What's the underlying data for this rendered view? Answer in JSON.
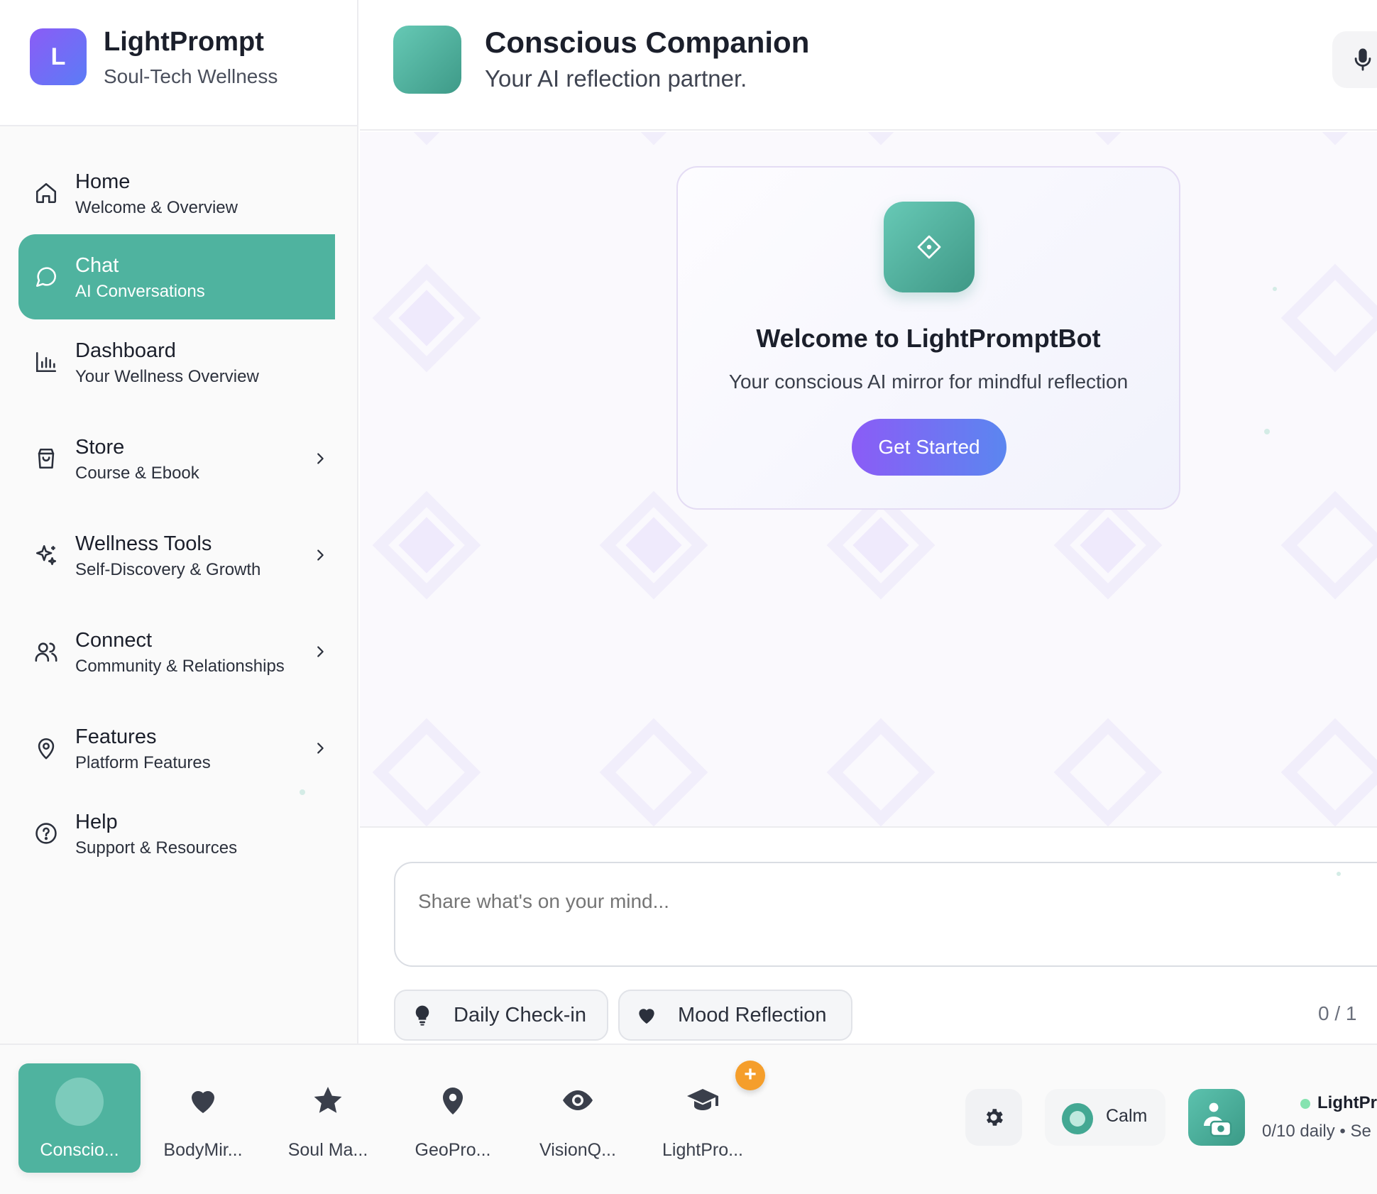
{
  "brand": {
    "logo_letter": "L",
    "name": "LightPrompt",
    "tagline": "Soul-Tech Wellness"
  },
  "nav": {
    "items": [
      {
        "title": "Home",
        "subtitle": "Welcome & Overview",
        "icon": "home-icon"
      },
      {
        "title": "Chat",
        "subtitle": "AI Conversations",
        "icon": "chat-bubble-icon",
        "active": true
      },
      {
        "title": "Dashboard",
        "subtitle": "Your Wellness Overview",
        "icon": "bar-chart-icon"
      },
      {
        "title": "Store",
        "subtitle": "Course & Ebook",
        "icon": "shopping-bag-icon"
      },
      {
        "title": "Wellness Tools",
        "subtitle": "Self-Discovery & Growth",
        "icon": "sparkles-icon"
      },
      {
        "title": "Connect",
        "subtitle": "Community & Relationships",
        "icon": "users-icon"
      },
      {
        "title": "Features",
        "subtitle": "Platform Features",
        "icon": "map-pin-icon"
      },
      {
        "title": "Help",
        "subtitle": "Support & Resources",
        "icon": "help-circle-icon"
      }
    ]
  },
  "header": {
    "title": "Conscious Companion",
    "subtitle": "Your AI reflection partner."
  },
  "welcome": {
    "title": "Welcome to LightPromptBot",
    "subtitle": "Your conscious AI mirror for mindful reflection",
    "cta": "Get Started"
  },
  "composer": {
    "placeholder": "Share what's on your mind...",
    "chips": [
      {
        "label": "Daily Check-in",
        "icon": "lightbulb-icon"
      },
      {
        "label": "Mood Reflection",
        "icon": "heart-icon"
      }
    ],
    "counter": "0 / 1"
  },
  "dock": {
    "apps": [
      {
        "label": "Conscio...",
        "icon": "avatar-icon",
        "active": true
      },
      {
        "label": "BodyMir...",
        "icon": "heart-icon"
      },
      {
        "label": "Soul Ma...",
        "icon": "star-icon"
      },
      {
        "label": "GeoPro...",
        "icon": "map-pin-icon"
      },
      {
        "label": "VisionQ...",
        "icon": "eye-icon"
      },
      {
        "label": "LightPro...",
        "icon": "graduation-cap-icon"
      }
    ],
    "badge": "+",
    "mood": "Calm",
    "user_name": "LightPro",
    "user_meta": "0/10 daily • Se"
  },
  "colors": {
    "accent": "#4fb39f",
    "brand_gradient_start": "#8b5cf6",
    "brand_gradient_end": "#5b86f0",
    "badge": "#f59e2b",
    "online": "#86e3b0"
  }
}
